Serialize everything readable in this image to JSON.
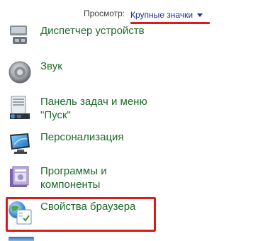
{
  "header": {
    "view_label": "Просмотр:",
    "view_value": "Крупные значки"
  },
  "items": [
    {
      "label": "Диспетчер устройств",
      "icon": "device-manager-icon"
    },
    {
      "label": "Звук",
      "icon": "speaker-icon"
    },
    {
      "label": "Панель задач и меню\n\"Пуск\"",
      "icon": "taskbar-icon"
    },
    {
      "label": "Персонализация",
      "icon": "personalization-icon"
    },
    {
      "label": "Программы и\nкомпоненты",
      "icon": "programs-icon"
    },
    {
      "label": "Свойства браузера",
      "icon": "internet-options-icon"
    }
  ],
  "colors": {
    "link_green": "#1e6b2a",
    "view_blue": "#1e3287",
    "highlight_red": "#d81b1b"
  }
}
